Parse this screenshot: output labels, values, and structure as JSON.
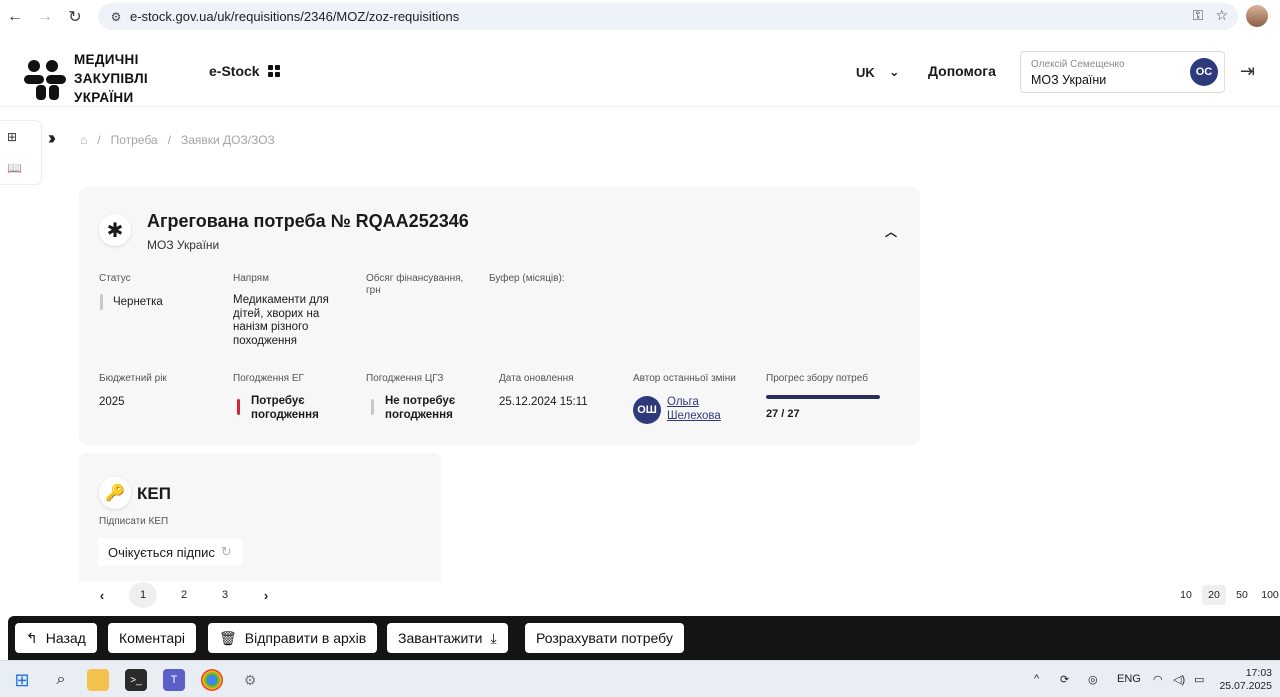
{
  "browser": {
    "url": "e-stock.gov.ua/uk/requisitions/2346/MOZ/zoz-requisitions"
  },
  "header": {
    "logo_lines": [
      "МЕДИЧНІ",
      "ЗАКУПІВЛІ",
      "УКРАЇНИ"
    ],
    "app_name": "e-Stock",
    "language": "UK",
    "help": "Допомога",
    "user_name": "Олексій Семещенко",
    "user_org": "МОЗ України",
    "user_initials": "ОС"
  },
  "breadcrumb": {
    "items": [
      "Потреба",
      "Заявки ДОЗ/ЗОЗ"
    ]
  },
  "card": {
    "title": "Агрегована потреба № RQAA252346",
    "subtitle": "МОЗ України",
    "fields": {
      "status_label": "Статус",
      "status_value": "Чернетка",
      "direction_label": "Напрям",
      "direction_value": "Медикаменти для дітей, хворих на нанізм різного походження",
      "funding_label": "Обсяг фінансування, грн",
      "buffer_label": "Буфер (місяців):",
      "budget_year_label": "Бюджетний рік",
      "budget_year_value": "2025",
      "eg_label": "Погодження ЕГ",
      "eg_value": "Потребує погодження",
      "cgz_label": "Погодження ЦГЗ",
      "cgz_value": "Не потребує погодження",
      "updated_label": "Дата оновлення",
      "updated_value": "25.12.2024 15:11",
      "author_label": "Автор останньої зміни",
      "author_initials": "ОШ",
      "author_name": "Ольга Шелехова",
      "progress_label": "Прогрес збору потреб",
      "progress_text": "27 / 27",
      "progress_fraction": 1.0
    },
    "colors": {
      "status_draft": "#c8c8c8",
      "eg_required": "#d6243a",
      "cgz_not_required": "#c8c8c8",
      "accent": "#2f3a7a"
    }
  },
  "kep": {
    "title": "КЕП",
    "label": "Підписати КЕП",
    "status": "Очікується підпис"
  },
  "pagination": {
    "pages": [
      "1",
      "2",
      "3"
    ],
    "active_page": "1",
    "page_sizes": [
      "10",
      "20",
      "50",
      "100"
    ]
  },
  "actions": {
    "back": "Назад",
    "comments": "Коментарі",
    "archive": "Відправити в архів",
    "download": "Завантажити",
    "calculate": "Розрахувати потребу"
  },
  "taskbar": {
    "lang": "ENG",
    "time": "17:03",
    "date": "25.07.2025"
  }
}
